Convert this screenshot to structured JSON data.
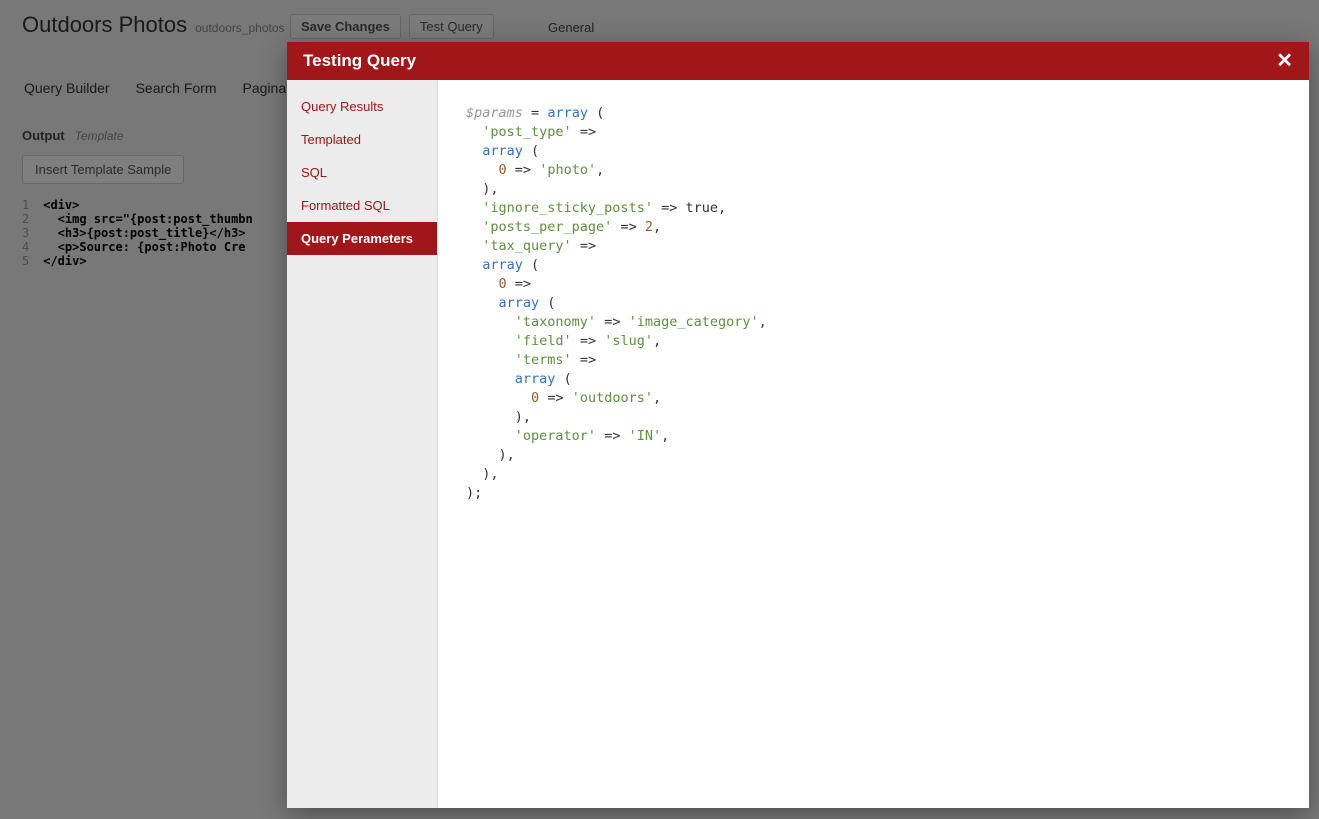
{
  "header": {
    "title": "Outdoors Photos",
    "slug": "outdoors_photos",
    "save_label": "Save Changes",
    "test_label": "Test Query",
    "general_label": "General"
  },
  "tabs": {
    "query_builder": "Query Builder",
    "search_form": "Search Form",
    "pagination": "Paginati"
  },
  "output": {
    "label": "Output",
    "sublabel": "Template",
    "sample_btn": "Insert Template Sample",
    "lines": [
      "<div>",
      "  <img src=\"{post:post_thumbn",
      "  <h3>{post:post_title}</h3>",
      "  <p>Source: {post:Photo Cre",
      "</div>"
    ]
  },
  "modal": {
    "title": "Testing Query",
    "close_glyph": "✕",
    "side_items": [
      "Query Results",
      "Templated",
      "SQL",
      "Formatted SQL",
      "Query Perameters"
    ],
    "active_side_index": 4,
    "php": {
      "var": "$params",
      "t": {
        "array": "array",
        "true": "true",
        "post_type": "'post_type'",
        "photo": "'photo'",
        "ignore": "'ignore_sticky_posts'",
        "ppp": "'posts_per_page'",
        "ppp_val": "2",
        "tax_query": "'tax_query'",
        "taxonomy": "'taxonomy'",
        "image_category": "'image_category'",
        "field": "'field'",
        "slug": "'slug'",
        "terms": "'terms'",
        "outdoors": "'outdoors'",
        "operator": "'operator'",
        "in": "'IN'",
        "zero": "0"
      }
    }
  }
}
